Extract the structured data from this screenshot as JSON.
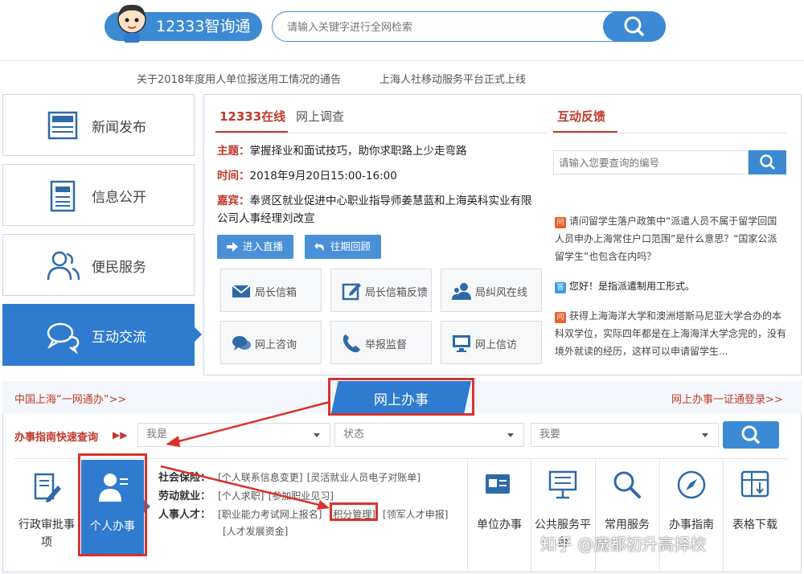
{
  "header": {
    "brand": "12333智询通",
    "search_placeholder": "请输入关键字进行全网检索"
  },
  "notices": [
    "关于2018年度用人单位报送用工情况的通告",
    "上海人社移动服务平台正式上线"
  ],
  "sidebar": {
    "items": [
      {
        "label": "新闻发布",
        "icon": "news-icon"
      },
      {
        "label": "信息公开",
        "icon": "document-icon"
      },
      {
        "label": "便民服务",
        "icon": "users-icon"
      },
      {
        "label": "互动交流",
        "icon": "chat-icon"
      }
    ],
    "active_index": 3
  },
  "center": {
    "tabs": [
      "12333在线",
      "网上调查"
    ],
    "topic_label": "主题：",
    "topic": "掌握择业和面试技巧，助你求职路上少走弯路",
    "time_label": "时间：",
    "time": "2018年9月20日15:00-16:00",
    "guest_label": "嘉宾：",
    "guest_line1": "奉贤区就业促进中心职业指导师姜慧蓝和上海英科实业有限",
    "guest_line2": "公司人事经理刘改宣",
    "btn_live": "进入直播",
    "btn_review": "往期回顾",
    "tiles": [
      "局长信箱",
      "局长信箱反馈",
      "局纠风在线",
      "网上咨询",
      "举报监督",
      "网上信访"
    ]
  },
  "feedback": {
    "title": "互动反馈",
    "search_placeholder": "请输入您要查询的编号",
    "q_tag": "问",
    "a_tag": "答",
    "q1_line1": "请问留学生落户政策中“派遣人员不属于留学回国",
    "q1_line2": "人员申办上海常住户口范围”是什么意思？“国家公派",
    "q1_line3": "留学生”也包含在内吗？",
    "a1": "您好！是指派遣制用工形式。",
    "q2_line1": "获得上海海洋大学和澳洲塔斯马尼亚大学合办的本",
    "q2_line2": "科双学位，实际四年都是在上海海洋大学念完的，没有",
    "q2_line3": "境外就读的经历，这样可以申请留学生..."
  },
  "bottom": {
    "left_link": "中国上海“一网通办”>>",
    "center_title": "网上办事",
    "right_link": "网上办事一证通登录>>",
    "guide_label": "办事指南快速查询",
    "selects": [
      "我是",
      "状态",
      "我要"
    ],
    "left_services": [
      "行政审批事项",
      "个人办事"
    ],
    "categories": [
      {
        "key": "社会保险：",
        "items": [
          "[个人联系信息变更]",
          "[灵活就业人员电子对账单]"
        ]
      },
      {
        "key": "劳动就业：",
        "items": [
          "[个人求职]",
          "[参加职业见习]"
        ]
      },
      {
        "key": "人事人才：",
        "items": [
          "[职业能力考试网上报名]",
          "[积分管理]",
          "[领军人才申报]"
        ]
      },
      {
        "key": "",
        "items": [
          "[人才发展资金]"
        ]
      }
    ],
    "right_services": [
      "单位办事",
      "公共服务平台",
      "常用服务",
      "办事指南",
      "表格下载"
    ]
  },
  "watermark": "知乎 @魔都初升高择校",
  "colors": {
    "primary": "#2e7bd0",
    "accent_red": "#d9322d",
    "link_red": "#c0392b"
  }
}
